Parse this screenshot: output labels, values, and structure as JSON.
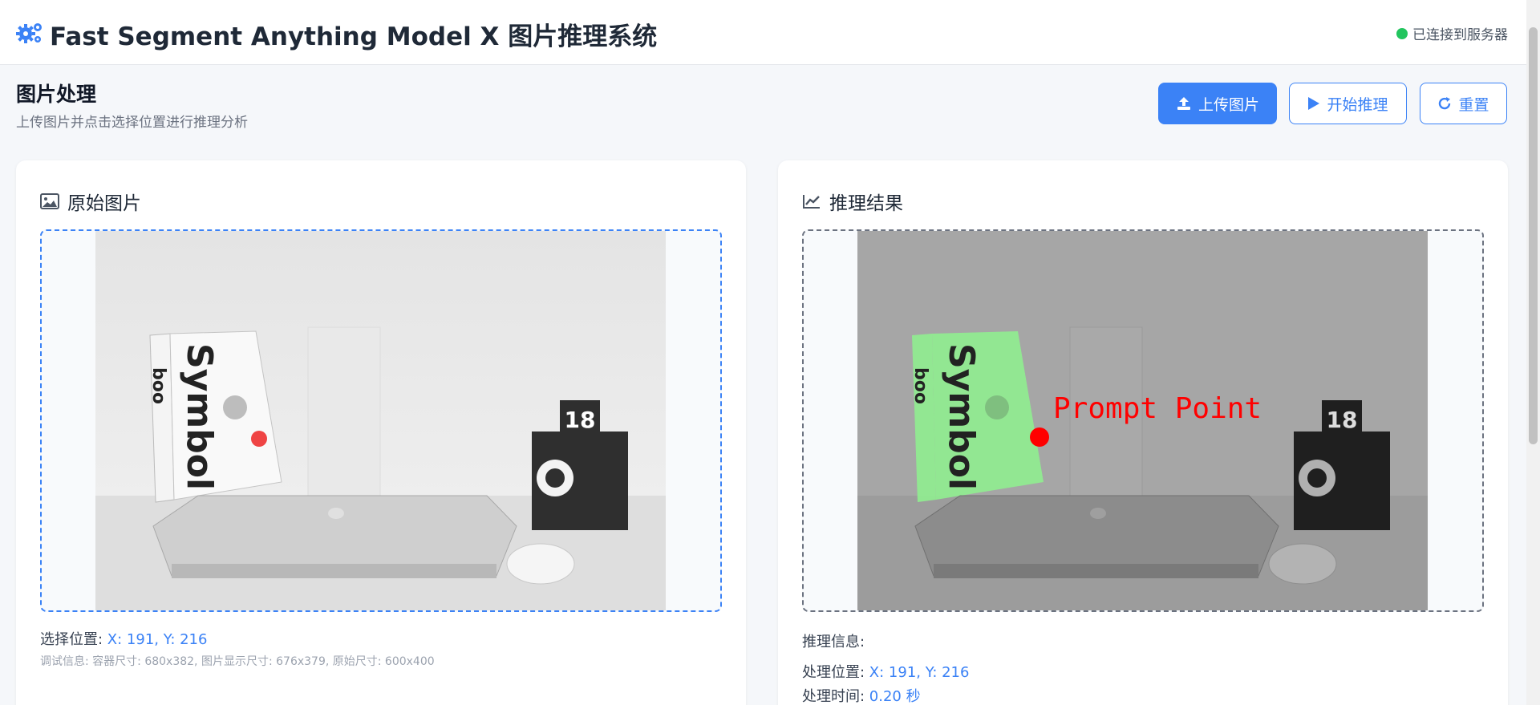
{
  "header": {
    "title": "Fast Segment Anything Model X 图片推理系统",
    "status": "已连接到服务器",
    "status_color": "#22c55e",
    "icon": "gears-icon"
  },
  "section": {
    "title": "图片处理",
    "subtitle": "上传图片并点击选择位置进行推理分析"
  },
  "toolbar": {
    "upload_label": "上传图片",
    "start_label": "开始推理",
    "reset_label": "重置"
  },
  "original_panel": {
    "title": "原始图片",
    "icon": "image-icon",
    "position_label": "选择位置: ",
    "position_value": "X: 191, Y: 216",
    "debug": "调试信息: 容器尺寸: 680x382, 图片显示尺寸: 676x379, 原始尺寸: 600x400"
  },
  "result_panel": {
    "title": "推理结果",
    "icon": "chart-line-icon",
    "info_heading": "推理信息:",
    "processed_position_label": "处理位置: ",
    "processed_position_value": "X: 191, Y: 216",
    "processing_time_label": "处理时间: ",
    "processing_time_value": "0.20 秒",
    "prompt_label": "Prompt Point"
  },
  "photo": {
    "book_title": "Symbol",
    "book_logo": "boo",
    "calendar_day": "18"
  },
  "colors": {
    "accent": "#3b82f6",
    "prompt_point_original": "#ef4444",
    "prompt_point_result": "#ff0000",
    "mask_fill": "#90ee90"
  }
}
